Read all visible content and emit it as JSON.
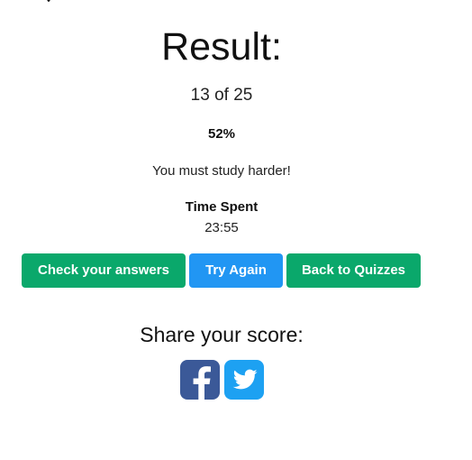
{
  "result": {
    "title": "Result:",
    "score_text": "13 of 25",
    "percent_text": "52%",
    "message": "You must study harder!",
    "time_label": "Time Spent",
    "time_value": "23:55"
  },
  "actions": {
    "check_answers_label": "Check your answers",
    "try_again_label": "Try Again",
    "back_to_quizzes_label": "Back to Quizzes"
  },
  "share": {
    "title": "Share your score:",
    "icons": [
      "facebook-icon",
      "twitter-icon"
    ]
  },
  "colors": {
    "green": "#0aa86b",
    "blue": "#2196f3",
    "facebook": "#3b5998",
    "twitter": "#1da1f2"
  }
}
